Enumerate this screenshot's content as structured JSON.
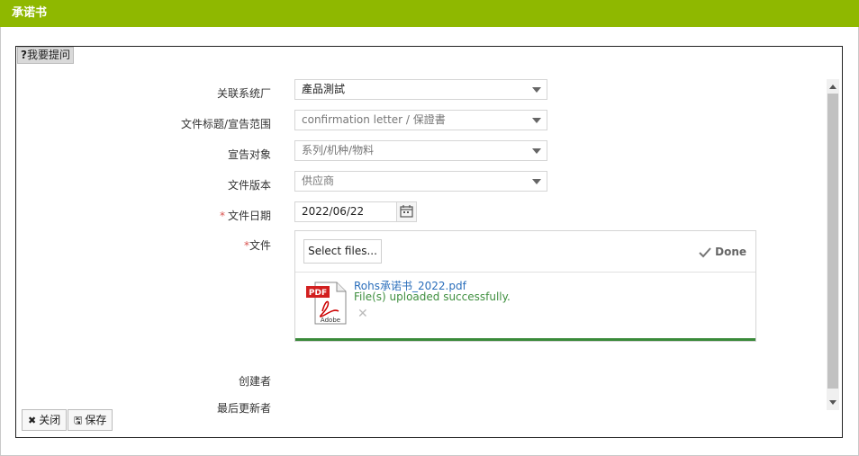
{
  "window": {
    "title": "承诺书"
  },
  "help": {
    "icon_text": "?",
    "label": "我要提问"
  },
  "form": {
    "factory": {
      "label": "关联系统厂",
      "value": "產品測試"
    },
    "doc_title": {
      "label": "文件标题/宣告范围",
      "value": "confirmation letter / 保證書"
    },
    "target": {
      "label": "宣告对象",
      "value": "系列/机种/物料"
    },
    "version": {
      "label": "文件版本",
      "value": "供应商"
    },
    "date": {
      "required_mark": "*",
      "label": "文件日期",
      "value": "2022/06/22"
    },
    "file": {
      "required_mark": "*",
      "label": "文件"
    },
    "creator": {
      "label": "创建者"
    },
    "updater": {
      "label": "最后更新者"
    }
  },
  "upload": {
    "select_label": "Select files...",
    "done_label": "Done",
    "file_name": "Rohs承诺书_2022.pdf",
    "status": "File(s) uploaded successfully.",
    "progress": 1.0,
    "pdf_badge": "PDF",
    "pdf_brand": "Adobe"
  },
  "buttons": {
    "close": "关闭",
    "save": "保存"
  },
  "colors": {
    "header": "#8fb800",
    "link": "#2a6ebb",
    "success": "#3f8f3f",
    "required": "#d9534f"
  },
  "icons": [
    "help-icon",
    "chevron-down-icon",
    "calendar-icon",
    "check-icon",
    "pdf-file-icon",
    "remove-icon",
    "close-icon",
    "save-icon"
  ]
}
